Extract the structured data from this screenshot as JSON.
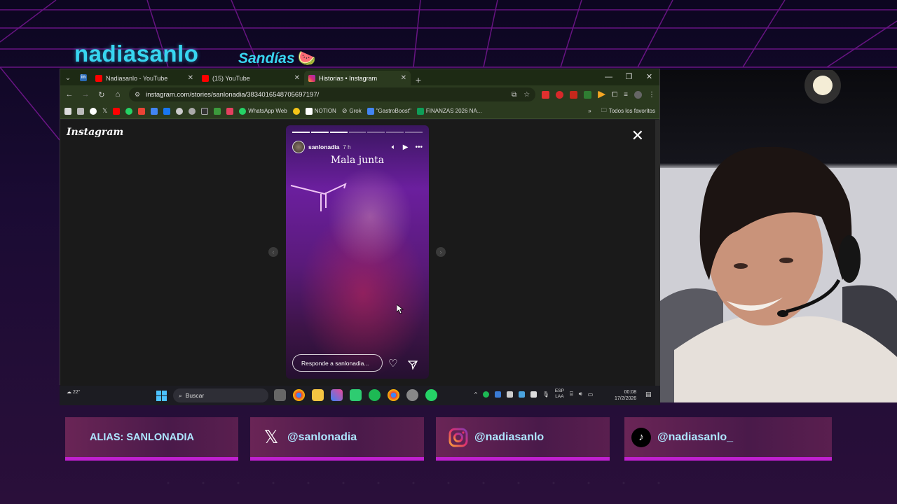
{
  "stream": {
    "title": "nadiasanlo",
    "subtitle": "Sandías",
    "subtitle_emoji": "🍉"
  },
  "browser": {
    "tabs": [
      {
        "title": "Nadiasanlo - YouTube",
        "icon": "youtube-icon",
        "active": false
      },
      {
        "title": "(15) YouTube",
        "icon": "youtube-icon",
        "active": false
      },
      {
        "title": "Historias • Instagram",
        "icon": "instagram-icon",
        "active": true
      }
    ],
    "url": "instagram.com/stories/sanlonadia/3834016548705697197/",
    "bookmarks": [
      "WhatsApp Web",
      "NOTION",
      "Grok",
      "\"GastroBoost\"",
      "FINANZAS 2026 NA..."
    ],
    "all_favorites": "Todos los favoritos"
  },
  "instagram": {
    "logo": "Instagram",
    "story": {
      "username": "sanlonadia",
      "time": "7 h",
      "text": "Mala junta",
      "reply_placeholder": "Responde a sanlonadia...",
      "progress_total": 7,
      "progress_done": 3
    }
  },
  "taskbar": {
    "temperature": "22°",
    "search_placeholder": "Buscar",
    "lang_top": "ESP",
    "lang_bottom": "LAA",
    "time": "00:08",
    "date": "17/2/2026"
  },
  "social": {
    "alias": "ALIAS: SANLONADIA",
    "x": "@sanlonadia",
    "instagram": "@nadiasanlo",
    "tiktok": "@nadiasanlo_"
  },
  "colors": {
    "accent_cyan": "#38d6f0",
    "accent_magenta": "#c020d0"
  }
}
